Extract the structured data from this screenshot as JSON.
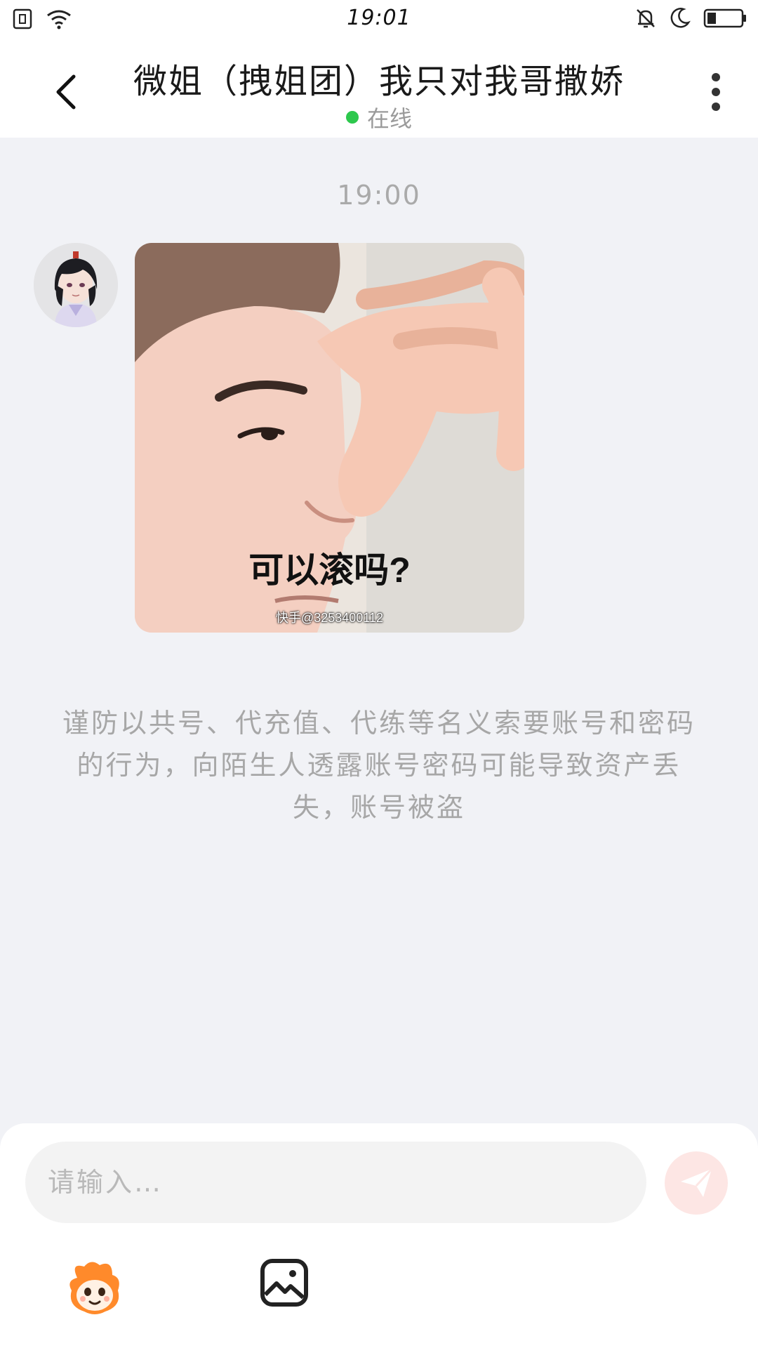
{
  "status_bar": {
    "time": "19:01",
    "icons": [
      "sim-icon",
      "wifi-icon",
      "bell-mute-icon",
      "moon-icon",
      "battery-icon"
    ],
    "battery_level": 0.25
  },
  "header": {
    "title": "微姐（拽姐团）我只对我哥撒娇",
    "status": "在线",
    "status_color": "#2dc84d"
  },
  "messages": [
    {
      "time": "19:00",
      "type": "sticker",
      "sticker_caption": "可以滚吗?",
      "sticker_watermark": "快手@3253400112"
    }
  ],
  "notice": "谨防以共号、代充值、代练等名义索要账号和密码的行为，向陌生人透露账号密码可能导致资产丢失，账号被盗",
  "input": {
    "placeholder": "请输入…",
    "send_color": "#fde6e4"
  }
}
